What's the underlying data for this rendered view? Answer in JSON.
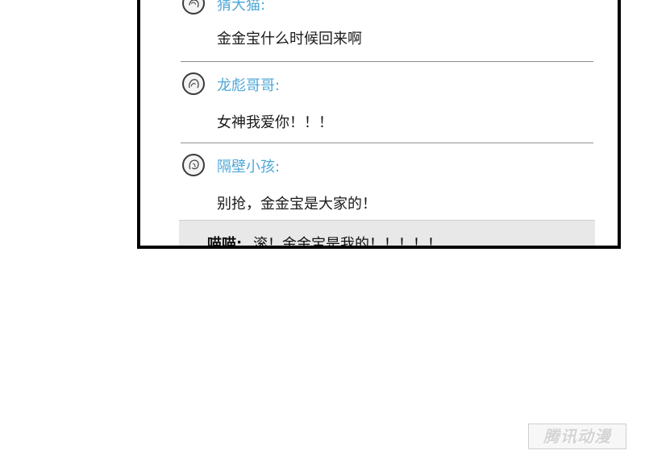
{
  "comments": [
    {
      "username": "猜大猫:",
      "avatar_icon": "avatar-icon",
      "message": "金金宝什么时候回来啊"
    },
    {
      "username": "龙彪哥哥:",
      "avatar_icon": "avatar-icon",
      "message": "女神我爱你！！！"
    },
    {
      "username": "隔壁小孩:",
      "avatar_icon": "avatar-icon",
      "message": "别抢，金金宝是大家的！"
    }
  ],
  "reply": {
    "name": "喵喵:",
    "text": "滚！金金宝是我的！！！！！"
  },
  "watermark": {
    "text": "腾讯动漫"
  },
  "colors": {
    "username": "#4ea7d9",
    "panel_border": "#000000",
    "reply_background": "#e8e8e8"
  }
}
